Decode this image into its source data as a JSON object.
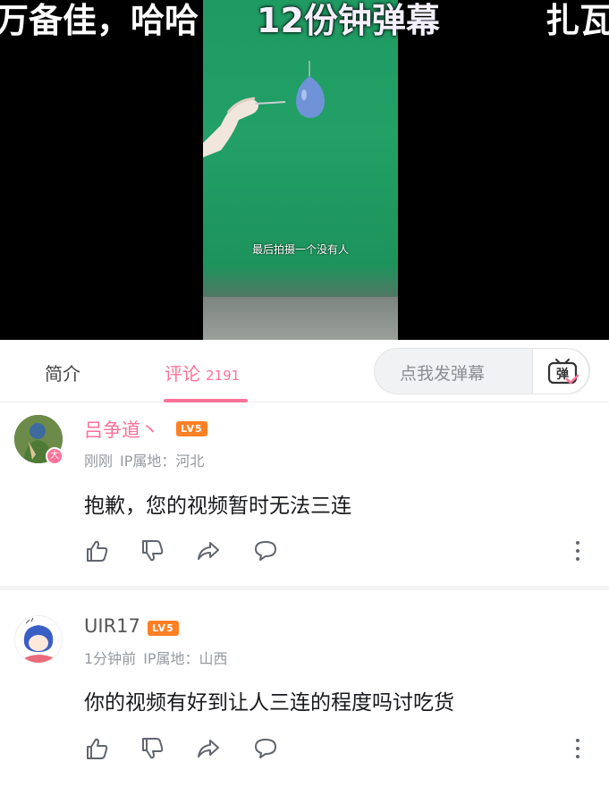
{
  "video": {
    "danmaku": [
      "万备佳，哈哈",
      "12份钟弹幕",
      "扎瓦"
    ],
    "subtitle": "最后拍摄一个没有人"
  },
  "tabs": {
    "intro_label": "简介",
    "comments_label": "评论",
    "comments_count": "2191"
  },
  "danmu": {
    "placeholder": "点我发弹幕",
    "button_label": "弹"
  },
  "comments": [
    {
      "username": "吕争道丶",
      "level": "LV5",
      "time": "刚刚",
      "ip": "IP属地：河北",
      "avatar_badge": "大",
      "text": "抱歉，您的视频暂时无法三连"
    },
    {
      "username": "UIR17",
      "level": "LV5",
      "time": "1分钟前",
      "ip": "IP属地：山西",
      "text": "你的视频有好到让人三连的程度吗讨吃货"
    }
  ],
  "colors": {
    "accent": "#fb7299",
    "level_badge": "#ff7f24",
    "video_bg": "#000000",
    "green_screen": "#22a066"
  }
}
